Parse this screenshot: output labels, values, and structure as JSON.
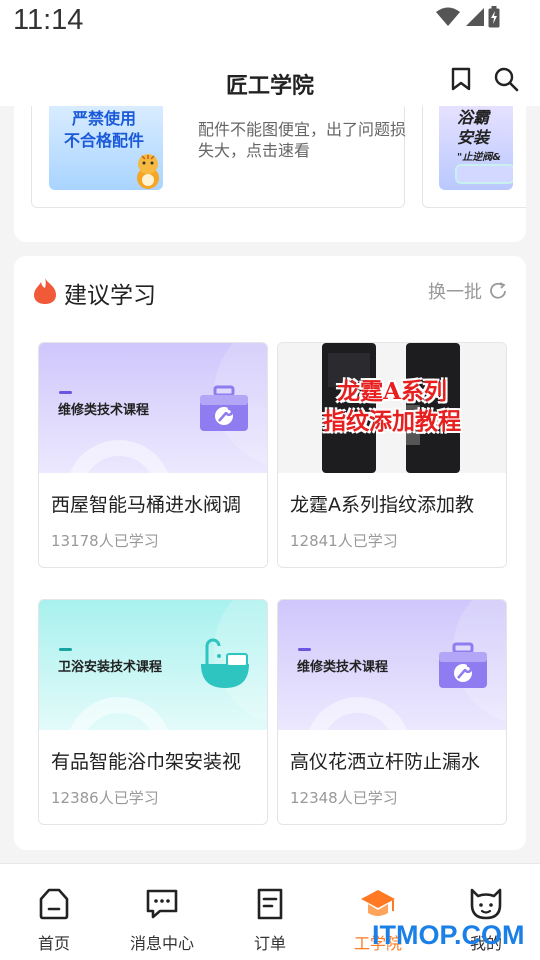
{
  "status_bar": {
    "time": "11:14"
  },
  "header": {
    "title": "匠工学院"
  },
  "top_card": {
    "banner1": {
      "img_line1": "严禁使用",
      "img_line2": "不合格配件",
      "text": "配件不能图便宜，出了问题损失大，点击速看"
    },
    "banner2": {
      "img_line1": "浴霸",
      "img_line2": "安装",
      "img_line3": "\"止逆阀&"
    }
  },
  "recommend": {
    "title": "建议学习",
    "refresh_label": "换一批",
    "courses": [
      {
        "cover_label": "维修类技术课程",
        "name": "西屋智能马桶进水阀调",
        "count": "13178人已学习"
      },
      {
        "cover_line1": "龙霆A系列",
        "cover_line2": "指纹添加教程",
        "name": "龙霆A系列指纹添加教",
        "count": "12841人已学习"
      },
      {
        "cover_label": "卫浴安装技术课程",
        "name": "有品智能浴巾架安装视",
        "count": "12386人已学习"
      },
      {
        "cover_label": "维修类技术课程",
        "name": "高仪花洒立杆防止漏水",
        "count": "12348人已学习"
      }
    ]
  },
  "bottom_nav": [
    {
      "label": "首页",
      "icon": "home-icon"
    },
    {
      "label": "消息中心",
      "icon": "message-icon"
    },
    {
      "label": "订单",
      "icon": "order-icon"
    },
    {
      "label": "工学院",
      "icon": "academy-icon",
      "active": true
    },
    {
      "label": "我的",
      "icon": "profile-icon"
    }
  ],
  "watermark": "ITMOP.COM",
  "colors": {
    "accent": "#ff7a22",
    "purple": "#8f7cf0",
    "teal": "#2ec4c0"
  }
}
